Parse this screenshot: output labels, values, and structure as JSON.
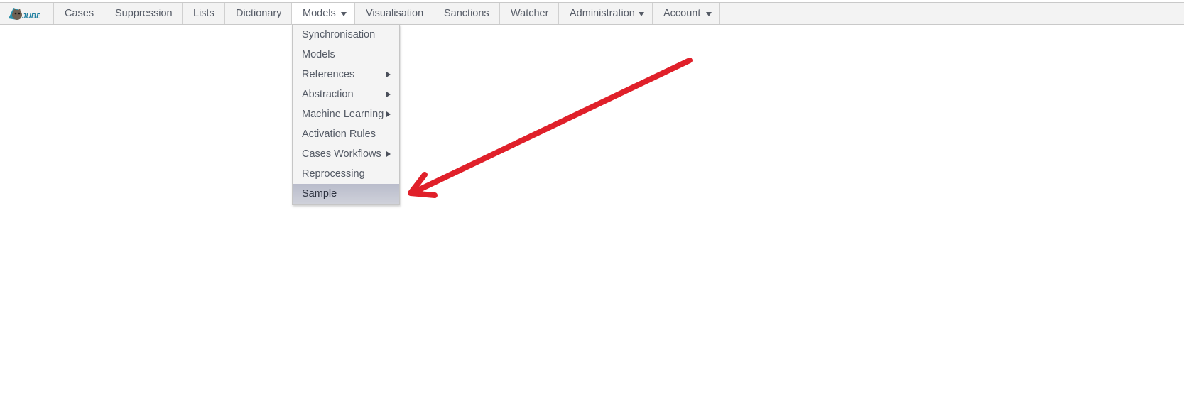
{
  "brand": {
    "logo_text": "JUBE",
    "logo_colors": {
      "mascot": "#5a6b5c",
      "accent": "#1f8fb0"
    }
  },
  "nav": {
    "items": [
      {
        "label": "Cases"
      },
      {
        "label": "Suppression"
      },
      {
        "label": "Lists"
      },
      {
        "label": "Dictionary"
      },
      {
        "label": "Models",
        "has_dropdown": true,
        "active": true
      },
      {
        "label": "Visualisation"
      },
      {
        "label": "Sanctions"
      },
      {
        "label": "Watcher"
      },
      {
        "label": "Administration",
        "has_dropdown": true
      },
      {
        "label": "Account",
        "has_dropdown": true
      }
    ]
  },
  "models_menu": {
    "items": [
      {
        "label": "Synchronisation"
      },
      {
        "label": "Models"
      },
      {
        "label": "References",
        "has_submenu": true
      },
      {
        "label": "Abstraction",
        "has_submenu": true
      },
      {
        "label": "Machine Learning",
        "has_submenu": true
      },
      {
        "label": "Activation Rules"
      },
      {
        "label": "Cases Workflows",
        "has_submenu": true
      },
      {
        "label": "Reprocessing"
      },
      {
        "label": "Sample",
        "highlighted": true
      }
    ]
  },
  "annotation": {
    "arrow_color": "#e0202a",
    "points_to": "Sample"
  },
  "colors": {
    "navbar_bg": "#f3f3f3",
    "nav_text": "#555b66",
    "menu_highlight": "#c3c6d1"
  }
}
